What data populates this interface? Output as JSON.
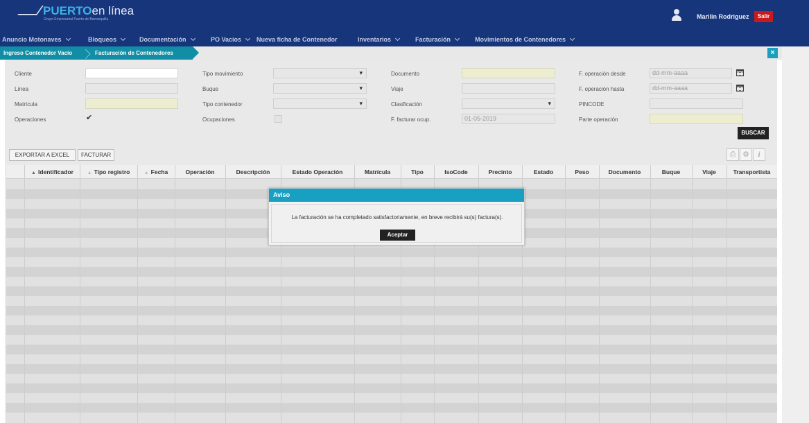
{
  "header": {
    "brand_bold": "PUERTO",
    "brand_light": "en línea",
    "tagline": "Grupo Empresarial Puerto de Barranquilla",
    "user_name": "Marilin Rodriguez",
    "logout_label": "Salir"
  },
  "nav": {
    "items": [
      {
        "label": "Anuncio Motonaves"
      },
      {
        "label": "Bloqueos"
      },
      {
        "label": "Documentación"
      },
      {
        "label": "PO Vacíos"
      },
      {
        "label": "Nueva ficha de Contenedor"
      },
      {
        "label": "Inventarios"
      },
      {
        "label": "Facturación"
      },
      {
        "label": "Movimientos de Contenedores"
      }
    ]
  },
  "breadcrumb": {
    "items": [
      "Ingreso Contenedor Vacío",
      "Facturación de Contenedores"
    ],
    "close_label": "×"
  },
  "form": {
    "cliente_label": "Cliente",
    "linea_label": "Línea",
    "matricula_label": "Matrícula",
    "operaciones_label": "Operaciones",
    "tipo_movimiento_label": "Tipo movimiento",
    "buque_label": "Buque",
    "tipo_contenedor_label": "Tipo contenedor",
    "ocupaciones_label": "Ocupaciones",
    "documento_label": "Documento",
    "viaje_label": "Viaje",
    "clasificacion_label": "Clasificación",
    "f_facturar_label": "F. facturar ocup.",
    "f_facturar_value": "01-05-2019",
    "f_desde_label": "F. operación desde",
    "f_desde_placeholder": "dd-mm-aaaa",
    "f_hasta_label": "F. operación hasta",
    "f_hasta_placeholder": "dd-mm-aaaa",
    "pincode_label": "PINCODE",
    "parte_label": "Parte operación",
    "operaciones_checked": true,
    "ocupaciones_checked": false,
    "buscar_label": "BUSCAR"
  },
  "toolbar": {
    "export_label": "EXPORTAR A EXCEL",
    "facturar_label": "FACTURAR",
    "icons": [
      "print-icon",
      "gear-icon",
      "info-icon"
    ]
  },
  "grid": {
    "columns": [
      "Identificador",
      "Tipo registro",
      "Fecha",
      "Operación",
      "Descripción",
      "Estado Operación",
      "Matrícula",
      "Tipo",
      "IsoCode",
      "Precinto",
      "Estado",
      "Peso",
      "Documento",
      "Buque",
      "Viaje",
      "Transportista"
    ],
    "rows": []
  },
  "modal": {
    "title": "Aviso",
    "message": "La facturación se ha completado satisfactoriamente, en breve recibirá su(s) factura(s).",
    "button_label": "Aceptar"
  },
  "colors": {
    "header_bg": "#17357a",
    "breadcrumb_bg": "#118da5",
    "modal_header": "#18a0c3",
    "logout_bg": "#c8191e"
  }
}
